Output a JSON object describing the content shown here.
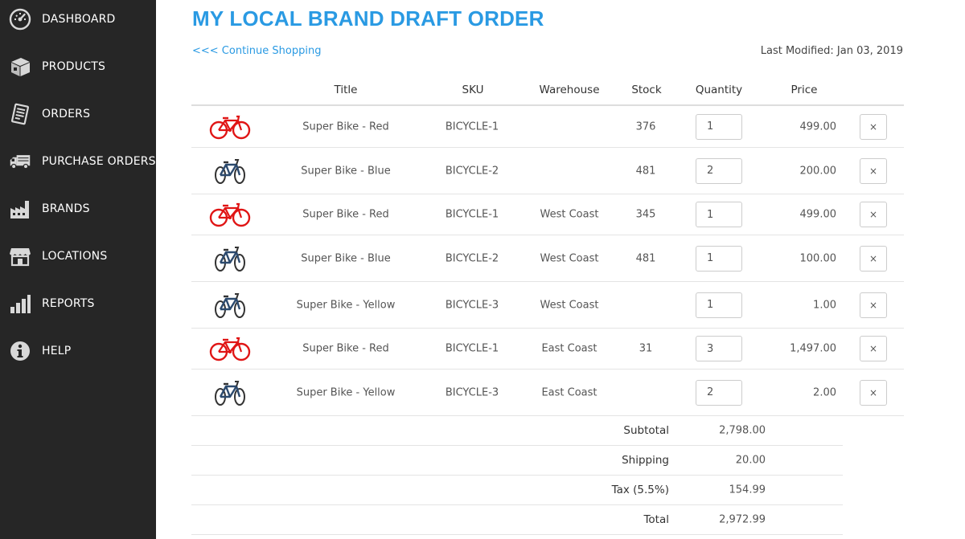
{
  "sidebar": {
    "items": [
      {
        "label": "DASHBOARD",
        "icon": "gauge-icon"
      },
      {
        "label": "PRODUCTS",
        "icon": "box-icon"
      },
      {
        "label": "ORDERS",
        "icon": "receipt-icon"
      },
      {
        "label": "PURCHASE ORDERS",
        "icon": "truck-icon"
      },
      {
        "label": "BRANDS",
        "icon": "factory-icon"
      },
      {
        "label": "LOCATIONS",
        "icon": "storefront-icon"
      },
      {
        "label": "REPORTS",
        "icon": "bar-chart-icon"
      },
      {
        "label": "HELP",
        "icon": "info-icon"
      }
    ]
  },
  "page": {
    "title": "MY LOCAL BRAND DRAFT ORDER",
    "continue_label": "<<< Continue Shopping",
    "last_modified": "Last Modified: Jan 03, 2019"
  },
  "table": {
    "headers": {
      "title": "Title",
      "sku": "SKU",
      "warehouse": "Warehouse",
      "stock": "Stock",
      "quantity": "Quantity",
      "price": "Price"
    },
    "remove_label": "×",
    "rows": [
      {
        "color": "red",
        "title": "Super Bike - Red",
        "sku": "BICYCLE-1",
        "warehouse": "",
        "stock": "376",
        "quantity": "1",
        "price": "499.00"
      },
      {
        "color": "blue",
        "title": "Super Bike - Blue",
        "sku": "BICYCLE-2",
        "warehouse": "",
        "stock": "481",
        "quantity": "2",
        "price": "200.00"
      },
      {
        "color": "red",
        "title": "Super Bike - Red",
        "sku": "BICYCLE-1",
        "warehouse": "West Coast",
        "stock": "345",
        "quantity": "1",
        "price": "499.00"
      },
      {
        "color": "blue",
        "title": "Super Bike - Blue",
        "sku": "BICYCLE-2",
        "warehouse": "West Coast",
        "stock": "481",
        "quantity": "1",
        "price": "100.00"
      },
      {
        "color": "blue",
        "title": "Super Bike - Yellow",
        "sku": "BICYCLE-3",
        "warehouse": "West Coast",
        "stock": "",
        "quantity": "1",
        "price": "1.00"
      },
      {
        "color": "red",
        "title": "Super Bike - Red",
        "sku": "BICYCLE-1",
        "warehouse": "East Coast",
        "stock": "31",
        "quantity": "3",
        "price": "1,497.00"
      },
      {
        "color": "blue",
        "title": "Super Bike - Yellow",
        "sku": "BICYCLE-3",
        "warehouse": "East Coast",
        "stock": "",
        "quantity": "2",
        "price": "2.00"
      }
    ]
  },
  "summary": {
    "subtotal_label": "Subtotal",
    "subtotal": "2,798.00",
    "shipping_label": "Shipping",
    "shipping": "20.00",
    "tax_label": "Tax (5.5%)",
    "tax": "154.99",
    "total_label": "Total",
    "total": "2,972.99"
  },
  "colors": {
    "sidebar_bg": "#262626",
    "accent": "#2a9ae3",
    "bike_red": "#e01515",
    "bike_blue": "#2c4a6e"
  }
}
